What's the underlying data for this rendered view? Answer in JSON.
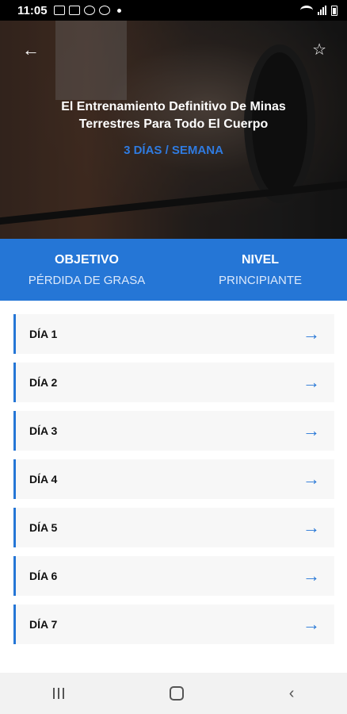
{
  "status_bar": {
    "time": "11:05"
  },
  "hero": {
    "title": "El Entrenamiento Definitivo De Minas Terrestres Para Todo El Cuerpo",
    "frequency": "3 DÍAS / SEMANA",
    "back_icon": "arrow-left-icon",
    "favorite_icon": "star-outline-icon"
  },
  "info": {
    "objective_label": "OBJETIVO",
    "objective_value": "PÉRDIDA DE GRASA",
    "level_label": "NIVEL",
    "level_value": "PRINCIPIANTE"
  },
  "days": [
    {
      "label": "DÍA 1"
    },
    {
      "label": "DÍA 2"
    },
    {
      "label": "DÍA 3"
    },
    {
      "label": "DÍA 4"
    },
    {
      "label": "DÍA 5"
    },
    {
      "label": "DÍA 6"
    },
    {
      "label": "DÍA 7"
    }
  ],
  "colors": {
    "accent": "#2576d6",
    "band_text": "#dbe8fb",
    "item_bg": "#f7f7f7"
  }
}
